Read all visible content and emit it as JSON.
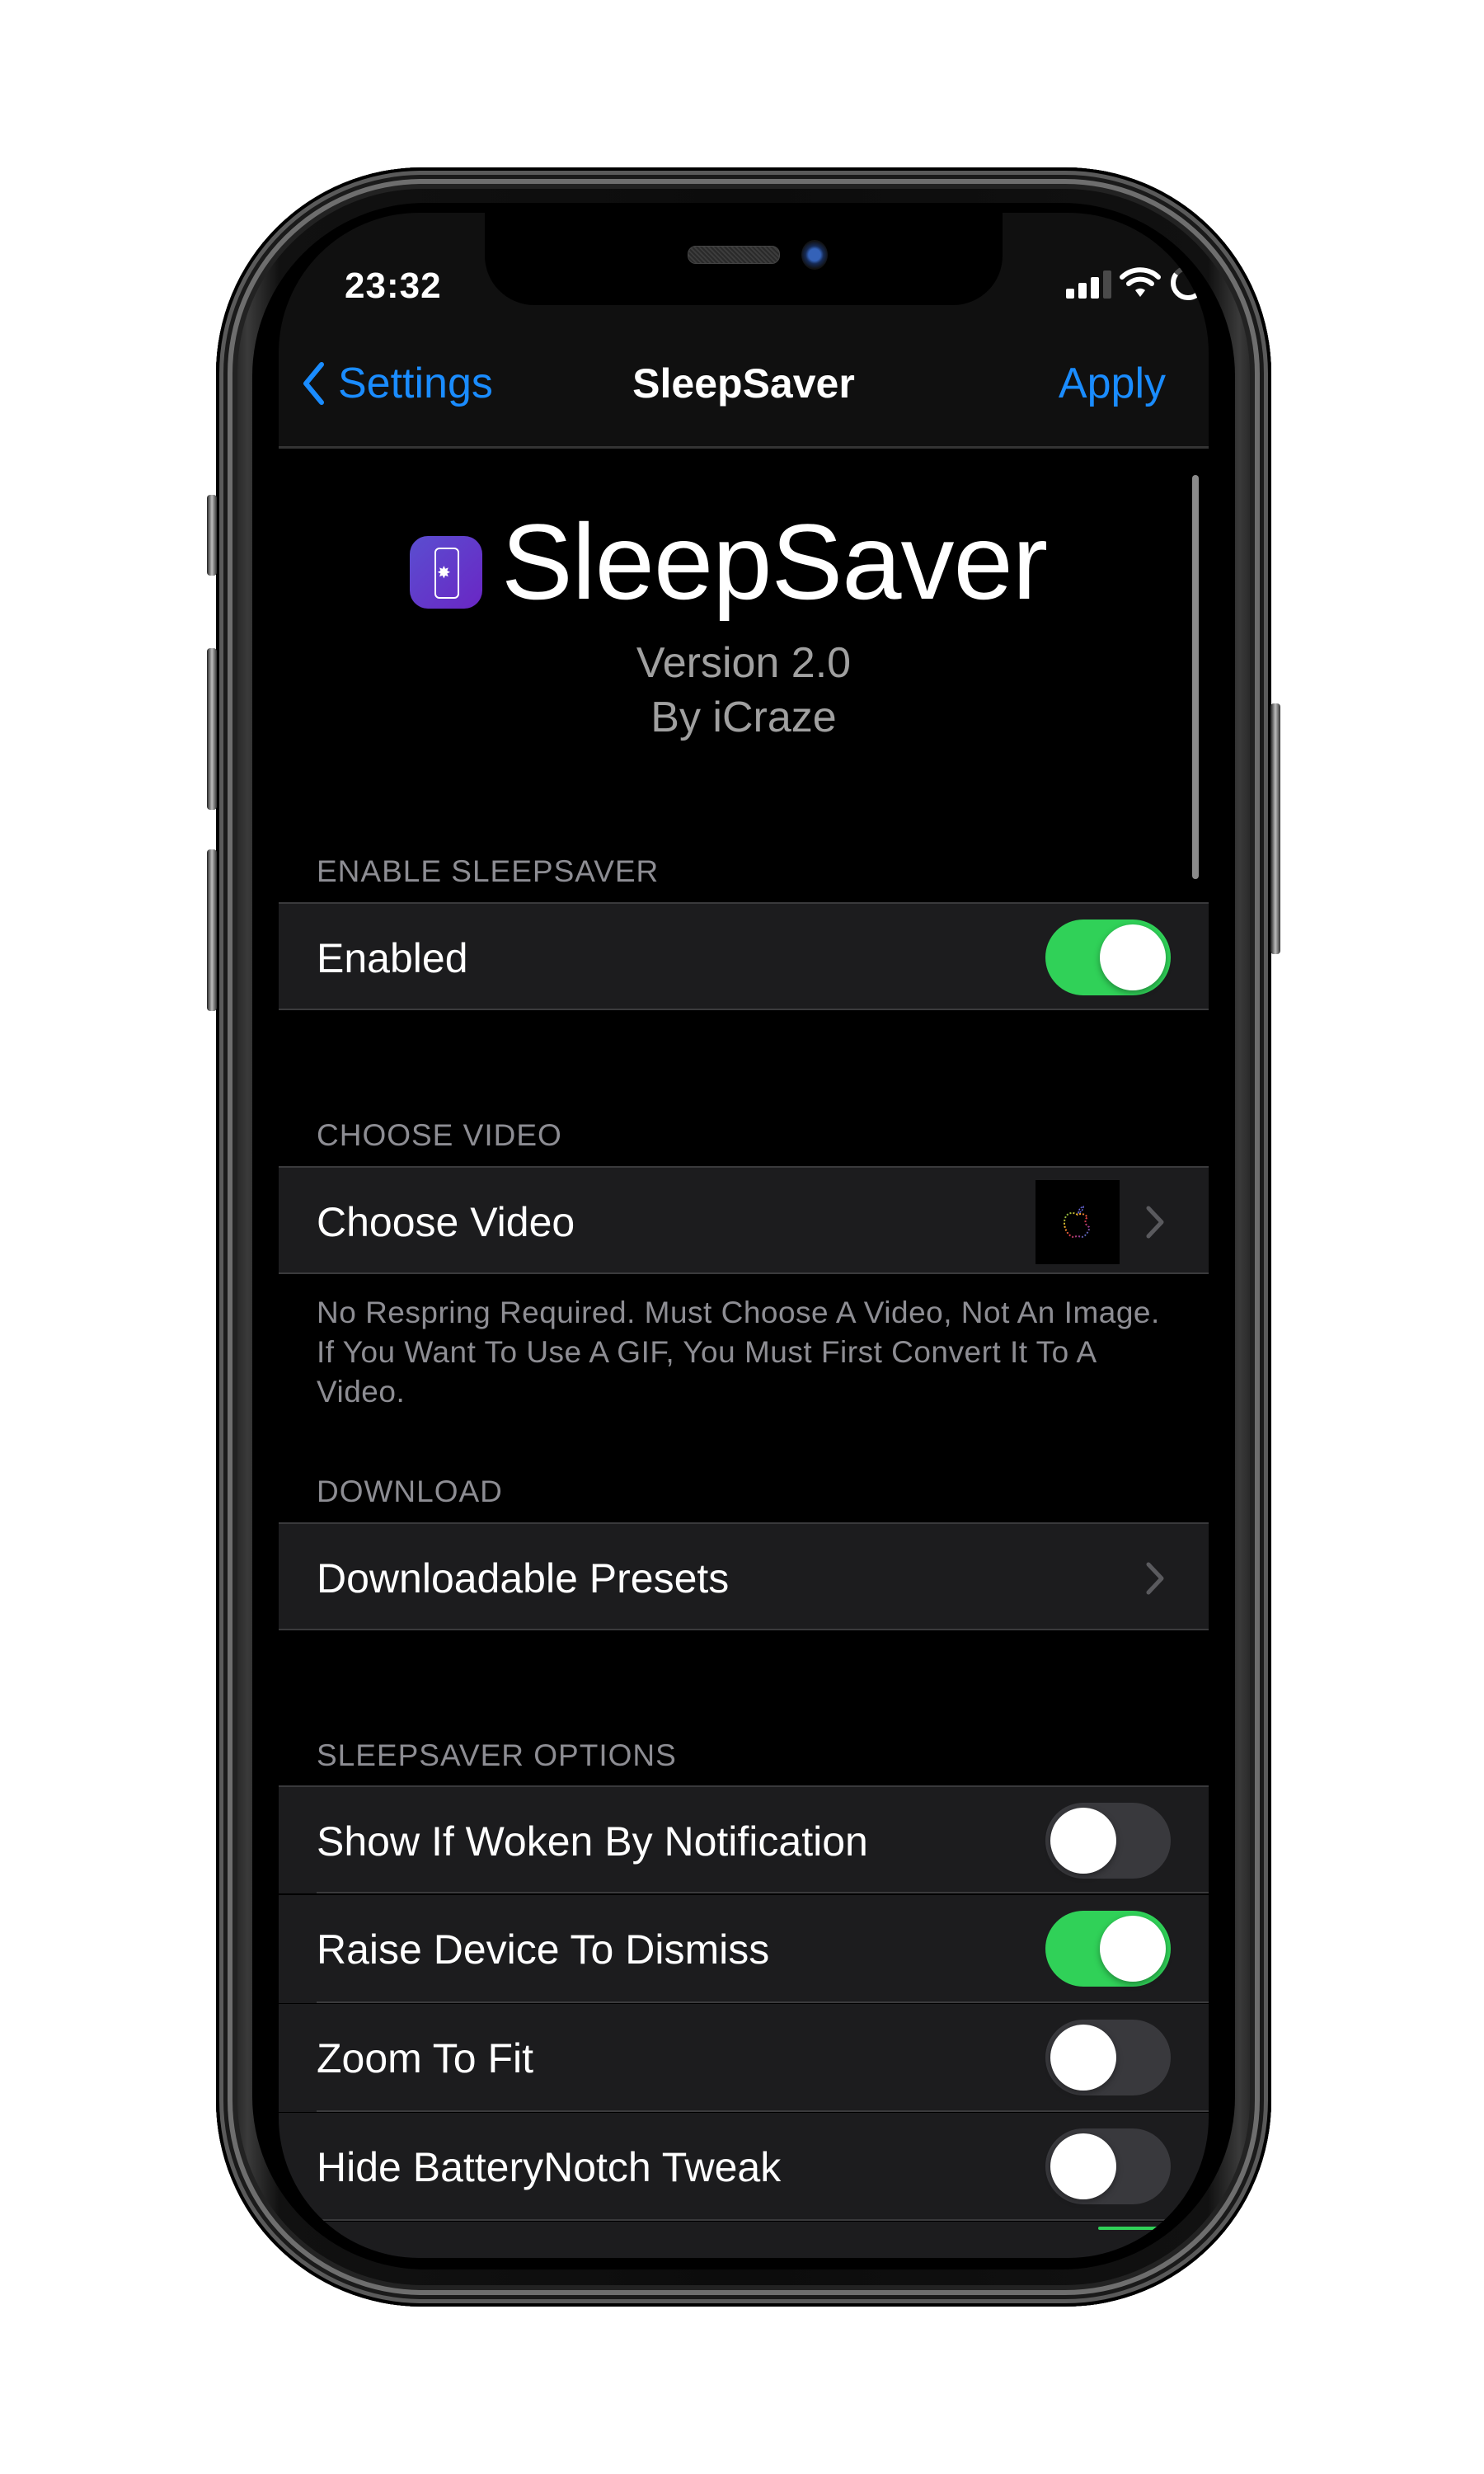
{
  "status_bar": {
    "time": "23:32",
    "signal_bars_active": 3,
    "signal_bars_total": 4,
    "wifi_icon": "wifi-icon",
    "battery_ring_level": 0.85
  },
  "nav": {
    "back_label": "Settings",
    "title": "SleepSaver",
    "action_label": "Apply"
  },
  "header": {
    "app_name": "SleepSaver",
    "icon": "phone-sparkle-app-icon",
    "version": "Version 2.0",
    "author": "By iCraze"
  },
  "sections": {
    "enable": {
      "header": "ENABLE SLEEPSAVER",
      "rows": [
        {
          "label": "Enabled",
          "type": "toggle",
          "value": true
        }
      ]
    },
    "video": {
      "header": "CHOOSE VIDEO",
      "rows": [
        {
          "label": "Choose Video",
          "type": "link",
          "thumbnail": "rainbow-apple-logo"
        }
      ],
      "footer": "No Respring Required. Must Choose A Video, Not An Image. If You Want To Use A GIF, You Must First Convert It To A Video."
    },
    "download": {
      "header": "DOWNLOAD",
      "rows": [
        {
          "label": "Downloadable Presets",
          "type": "link"
        }
      ]
    },
    "options": {
      "header": "SLEEPSAVER OPTIONS",
      "rows": [
        {
          "label": "Show If Woken By Notification",
          "type": "toggle",
          "value": false
        },
        {
          "label": "Raise Device To Dismiss",
          "type": "toggle",
          "value": true
        },
        {
          "label": "Zoom To Fit",
          "type": "toggle",
          "value": false
        },
        {
          "label": "Hide BatteryNotch Tweak",
          "type": "toggle",
          "value": false
        }
      ],
      "partially_visible_next_toggle": true
    }
  },
  "colors": {
    "accent_blue": "#1a8cff",
    "toggle_on": "#30d158",
    "toggle_off": "#39393d",
    "cell_bg": "#1c1c1e",
    "secondary_text": "#8d8d93"
  }
}
